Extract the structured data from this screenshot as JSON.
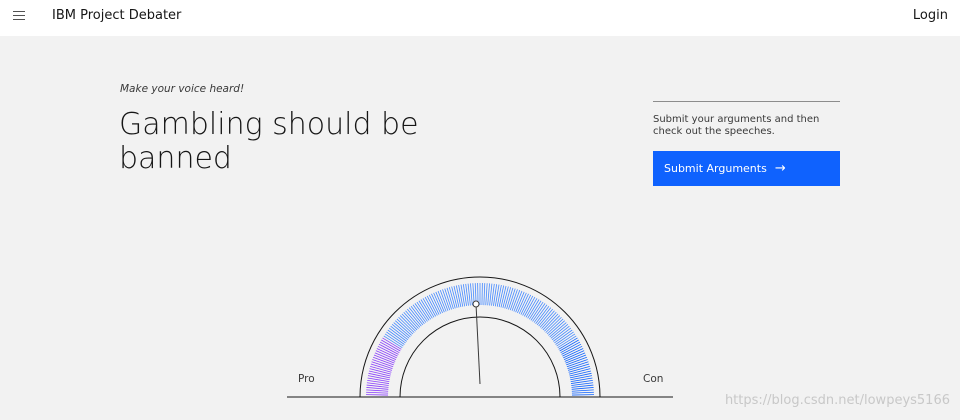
{
  "header": {
    "menu_icon": "hamburger-menu-icon",
    "brand": "IBM Project Debater",
    "login": "Login"
  },
  "main": {
    "tagline": "Make your voice heard!",
    "title": "Gambling should be banned"
  },
  "side": {
    "text": "Submit your arguments and then check out the speeches.",
    "button_label": "Submit Arguments",
    "button_icon": "arrow-right-icon"
  },
  "gauge": {
    "pro_label": "Pro",
    "con_label": "Con",
    "needle_lean_pro_deg": 2,
    "colors": {
      "pro": "#8a3ffc",
      "neutral": "#4589ff",
      "con": "#0f62fe",
      "button": "#0f62fe"
    }
  },
  "watermark": "https://blog.csdn.net/lowpeys5166"
}
